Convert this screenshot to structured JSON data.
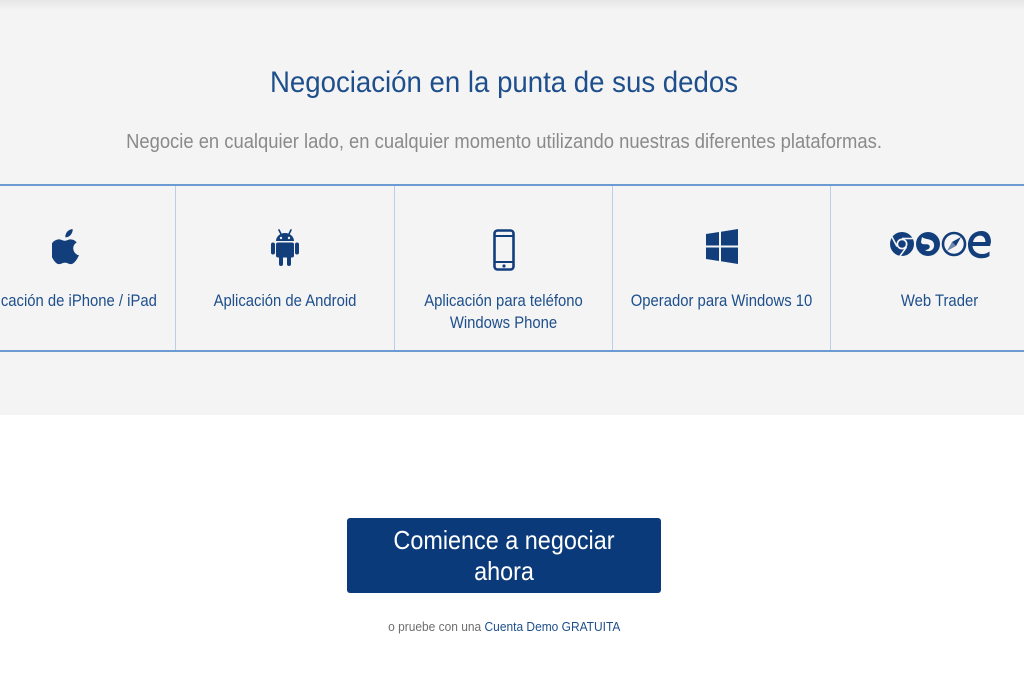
{
  "platforms_section": {
    "title": "Negociación en la punta de sus dedos",
    "subtitle": "Negocie en cualquier lado, en cualquier momento utilizando nuestras diferentes plataformas.",
    "cards": [
      {
        "label": "Aplicación de iPhone / iPad",
        "icon": "apple-icon"
      },
      {
        "label": "Aplicación de Android",
        "icon": "android-icon"
      },
      {
        "label": "Aplicación para teléfono\nWindows Phone",
        "icon": "smartphone-icon"
      },
      {
        "label": "Operador para Windows 10",
        "icon": "windows-icon"
      },
      {
        "label": "Web Trader",
        "icon": "browsers-icon"
      }
    ]
  },
  "cta": {
    "button_label": "Comience a negociar ahora",
    "demo_prefix": "o pruebe con una",
    "demo_link": "Cuenta Demo GRATUITA"
  },
  "colors": {
    "primary": "#0a3a7a",
    "accent_text": "#1e4f8c",
    "section_bg": "#f4f4f4",
    "border": "#6b9bd1"
  }
}
